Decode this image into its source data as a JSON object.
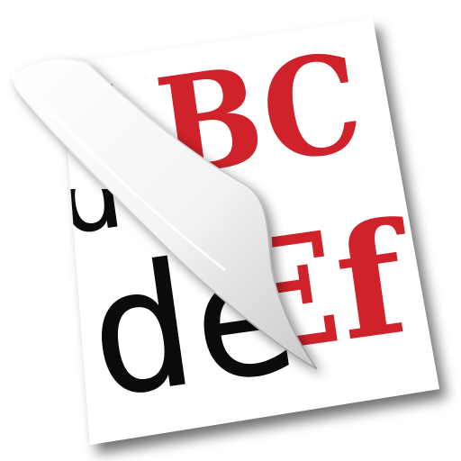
{
  "icon": {
    "name": "text-case-converter-app-icon",
    "upper_text": "ABC",
    "lower_visible_text": "de",
    "under_curl_hint": "d",
    "lower_hidden_char": "f",
    "right_red_text": "Ef"
  },
  "colors": {
    "red": "#d0222a",
    "black": "#0b0b0b",
    "paper": "#ffffff",
    "shadow": "#000000"
  }
}
